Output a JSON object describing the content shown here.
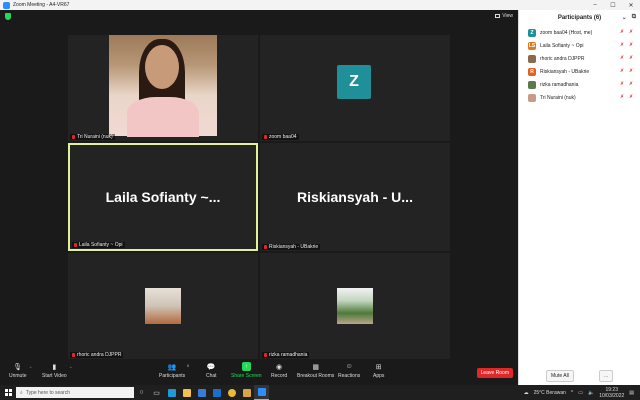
{
  "window": {
    "title": "Zoom Meeting - A4-VR67"
  },
  "meeting": {
    "view_label": "View",
    "tiles": [
      {
        "name": "Tri Nuraini (nuk)",
        "display": "video"
      },
      {
        "name": "zoom baa04",
        "display": "avatar",
        "initial": "Z"
      },
      {
        "name": "Laila Sofianty ~ Opi",
        "display": "text",
        "big_text": "Laila Sofianty ~...",
        "active": true
      },
      {
        "name": "Riskiansyah - UBakrie",
        "display": "text",
        "big_text": "Riskiansyah - U..."
      },
      {
        "name": "rhoric andra DJPPR",
        "display": "thumb"
      },
      {
        "name": "rizka ramadhania",
        "display": "thumb"
      }
    ]
  },
  "toolbar": {
    "unmute": "Unmute",
    "start_video": "Start Video",
    "participants": "Participants",
    "participants_count": "6",
    "chat": "Chat",
    "share_screen": "Share Screen",
    "record": "Record",
    "breakout": "Breakout Rooms",
    "reactions": "Reactions",
    "apps": "Apps",
    "leave": "Leave Room"
  },
  "panel": {
    "title": "Participants (6)",
    "participants": [
      {
        "name": "zoom baa04 (Host, me)",
        "initials": "Z",
        "color": "#1f8f9a"
      },
      {
        "name": "Laila Sofianty ~ Opi",
        "initials": "LS",
        "color": "#e07a1f"
      },
      {
        "name": "rhoric andra DJPPR",
        "initials": "",
        "color": "#8a6a4a"
      },
      {
        "name": "Riskiansyah - UBakrie",
        "initials": "R",
        "color": "#e0601f"
      },
      {
        "name": "rizka ramadhania",
        "initials": "",
        "color": "#5a7a4a"
      },
      {
        "name": "Tri Nuraini (nuk)",
        "initials": "",
        "color": "#c99a86"
      }
    ],
    "mute_all": "Mute All",
    "more": "..."
  },
  "taskbar": {
    "search_placeholder": "Type here to search",
    "weather": "25°C Berawan",
    "time": "19:23",
    "date": "10/03/2022"
  }
}
